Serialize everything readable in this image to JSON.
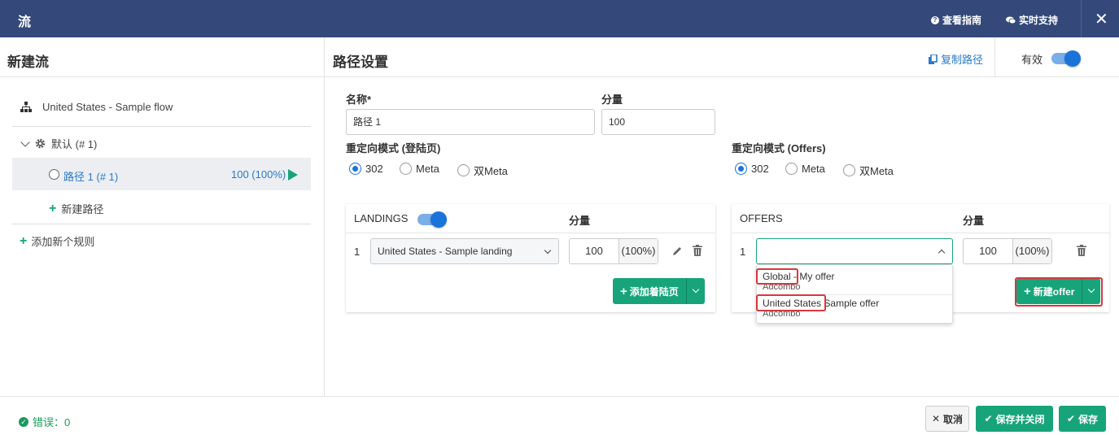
{
  "topbar": {
    "title": "流",
    "guide_label": "查看指南",
    "support_label": "实时支持"
  },
  "left": {
    "title": "新建流",
    "flow_name": "United States - Sample flow",
    "default_rule": "默认 (# 1)",
    "path_name": "路径 1 (# 1)",
    "path_share": "100 (100%)",
    "new_path": "新建路径",
    "add_rule": "添加新个规则"
  },
  "right": {
    "title": "路径设置",
    "copy_path": "复制路径",
    "valid_label": "有效",
    "valid_on": true,
    "name_label": "名称*",
    "name_value": "路径 1",
    "share_label": "分量",
    "share_value": "100",
    "redirect_landing_label": "重定向模式 (登陆页)",
    "redirect_offers_label": "重定向模式 (Offers)",
    "redirect_options": [
      "302",
      "Meta",
      "双Meta"
    ],
    "redirect_landing_selected": "302",
    "redirect_offers_selected": "302"
  },
  "landings": {
    "header": "LANDINGS",
    "enabled": true,
    "share_header": "分量",
    "rows": [
      {
        "index": "1",
        "name": "United States - Sample landing",
        "share": "100",
        "percent": "(100%)"
      }
    ],
    "add_button": "添加着陆页"
  },
  "offers": {
    "header": "OFFERS",
    "share_header": "分量",
    "rows": [
      {
        "index": "1",
        "name": "",
        "share": "100",
        "percent": "(100%)"
      }
    ],
    "new_button": "新建offer",
    "dropdown": [
      {
        "country": "Global",
        "sep": " - ",
        "name": "My offer",
        "network": "Adcombo"
      },
      {
        "country": "United States",
        "sep": " ",
        "name": "Sample offer",
        "network": "Adcombo"
      }
    ]
  },
  "footer": {
    "errors": "错误：0",
    "cancel": "取消",
    "save_close": "保存并关闭",
    "save": "保存"
  },
  "colors": {
    "topbar": "#34497a",
    "green": "#17a47b",
    "blue": "#1a73d9",
    "highlight": "#d9363e"
  }
}
